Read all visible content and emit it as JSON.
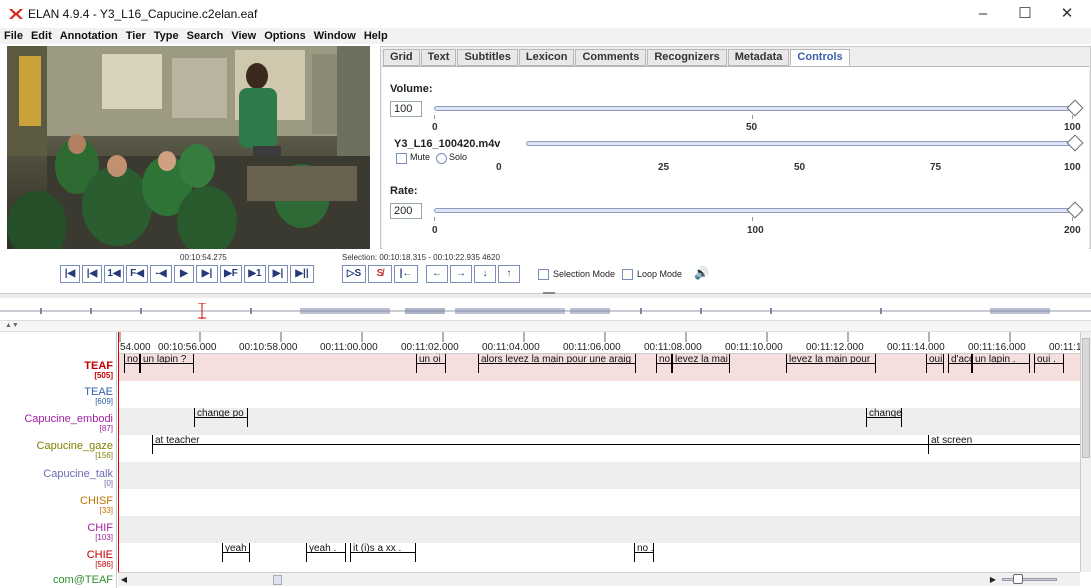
{
  "window": {
    "title": "ELAN 4.9.4 - Y3_L16_Capucine.c2elan.eaf",
    "minimize": "–",
    "maximize": "☐",
    "close": "✕"
  },
  "menu": [
    "File",
    "Edit",
    "Annotation",
    "Tier",
    "Type",
    "Search",
    "View",
    "Options",
    "Window",
    "Help"
  ],
  "tabs": [
    "Grid",
    "Text",
    "Subtitles",
    "Lexicon",
    "Comments",
    "Recognizers",
    "Metadata",
    "Controls"
  ],
  "active_tab": "Controls",
  "controls": {
    "volume_label": "Volume:",
    "volume_value": "100",
    "volume_ticks": [
      "0",
      "50",
      "100"
    ],
    "media_file": "Y3_L16_100420.m4v",
    "mute_label": "Mute",
    "solo_label": "Solo",
    "media_ticks": [
      "0",
      "25",
      "50",
      "75",
      "100"
    ],
    "rate_label": "Rate:",
    "rate_value": "200",
    "rate_ticks": [
      "0",
      "100",
      "200"
    ]
  },
  "transport": {
    "current_time": "00:10:54.275",
    "selection": "Selection: 00:10:18.315 - 00:10:22.935 4620",
    "selection_mode": "Selection Mode",
    "loop_mode": "Loop Mode",
    "buttons": [
      "|◀",
      "|◀",
      "1◀",
      "F◀",
      "-◀",
      "▶",
      "▶|",
      "▶F",
      "▶1",
      "▶|",
      "▶||"
    ],
    "sel_buttons": [
      "▷S",
      "S̸",
      "|←"
    ],
    "nav_buttons": [
      "←",
      "→",
      "↓",
      "↑"
    ]
  },
  "timeline": {
    "ticks": [
      "54.000",
      "00:10:56.000",
      "00:10:58.000",
      "00:11:00.000",
      "00:11:02.000",
      "00:11:04.000",
      "00:11:06.000",
      "00:11:08.000",
      "00:11:10.000",
      "00:11:12.000",
      "00:11:14.000",
      "00:11:16.000",
      "00:11:1"
    ]
  },
  "tiers": [
    {
      "name": "TEAF",
      "count": "[505]",
      "color": "#c00000",
      "bold": true
    },
    {
      "name": "TEAE",
      "count": "[609]",
      "color": "#3060b0",
      "bold": false
    },
    {
      "name": "Capucine_embodi",
      "count": "[87]",
      "color": "#a020a0",
      "bold": false
    },
    {
      "name": "Capucine_gaze",
      "count": "[156]",
      "color": "#808000",
      "bold": false
    },
    {
      "name": "Capucine_talk",
      "count": "[0]",
      "color": "#6a6ab0",
      "bold": false
    },
    {
      "name": "CHISF",
      "count": "[33]",
      "color": "#c07000",
      "bold": false
    },
    {
      "name": "CHIF",
      "count": "[103]",
      "color": "#a020a0",
      "bold": false
    },
    {
      "name": "CHIE",
      "count": "[586]",
      "color": "#c00000",
      "bold": false
    },
    {
      "name": "com@TEAF",
      "count": "",
      "color": "#309030",
      "bold": false
    }
  ],
  "annotations": {
    "TEAF": [
      "no",
      "un lapin ?",
      "un oi",
      "alors levez la main pour une araig",
      "no",
      "levez la mai",
      "levez la main pour",
      "oui",
      "d'acc",
      "un lapin .",
      "oui ."
    ],
    "Capucine_embodi": [
      "change po",
      "change"
    ],
    "Capucine_gaze": [
      "at teacher",
      "at screen"
    ],
    "CHIE": [
      "yeah",
      "yeah .",
      "it (i)s a xx .",
      "no ."
    ]
  }
}
